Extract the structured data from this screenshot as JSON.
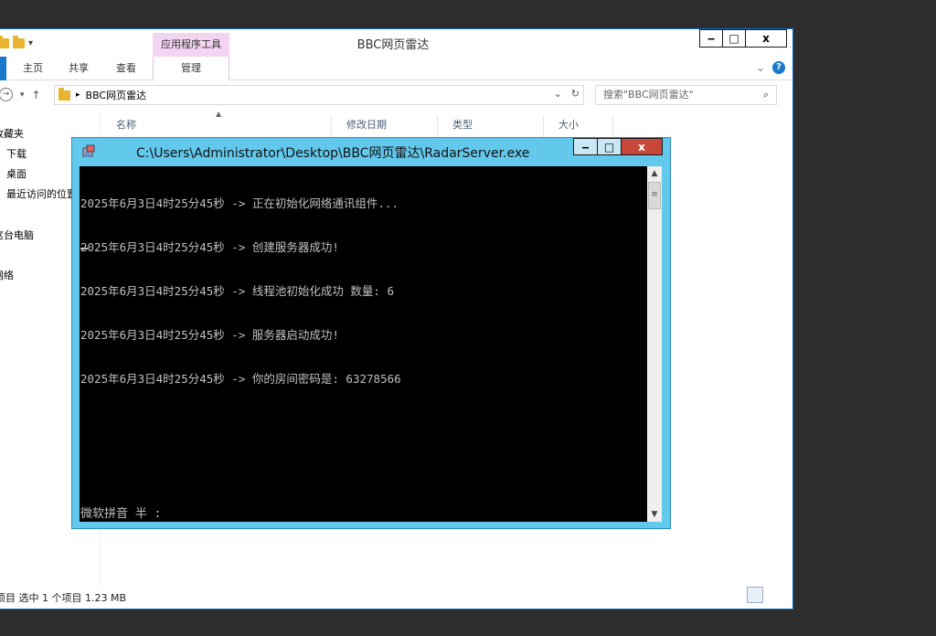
{
  "explorer": {
    "title": "BBC网页雷达",
    "qat_dropdown": "▾",
    "context_tab_header": "应用程序工具",
    "controls": {
      "minimize": "‒",
      "maximize": "□",
      "close": "x"
    },
    "ribbon": {
      "tabs": [
        "主页",
        "共享",
        "查看",
        "管理"
      ],
      "expand": "⌄",
      "help": "?"
    },
    "address": {
      "back": "→",
      "history": "▾",
      "up": "↑",
      "separator": "▸",
      "path": "BBC网页雷达",
      "dropdown": "⌄",
      "refresh": "↻"
    },
    "search": {
      "placeholder": "搜索\"BBC网页雷达\"",
      "icon": "⌕"
    },
    "nav_pane": [
      "收藏夹",
      "下载",
      "桌面",
      "最近访问的位置",
      "这台电脑",
      "网络"
    ],
    "columns": [
      "名称",
      "修改日期",
      "类型",
      "大小"
    ],
    "sort_arrow": "▲",
    "status": "项目    选中 1 个项目  1.23 MB"
  },
  "console": {
    "title": "C:\\Users\\Administrator\\Desktop\\BBC网页雷达\\RadarServer.exe",
    "controls": {
      "minimize": "‒",
      "maximize": "□",
      "close": "x"
    },
    "lines": [
      "2025年6月3日4时25分45秒 -> 正在初始化网络通讯组件...",
      "2025年6月3日4时25分45秒 -> 创建服务器成功!",
      "2025年6月3日4时25分45秒 -> 线程池初始化成功 数量: 6",
      "2025年6月3日4时25分45秒 -> 服务器启动成功!",
      "2025年6月3日4时25分45秒 -> 你的房间密码是: 63278566"
    ],
    "ime_status": "微软拼音 半 :",
    "scroll": {
      "up": "▲",
      "down": "▼",
      "thumb": "≡"
    }
  },
  "colors": {
    "desktop": "#2d2d2d",
    "console_frame": "#62c8ec",
    "console_text": "#c0c0c0",
    "close_red": "#c7473b",
    "context_tab": "#f3d4f1",
    "accent_blue": "#1979ca"
  }
}
